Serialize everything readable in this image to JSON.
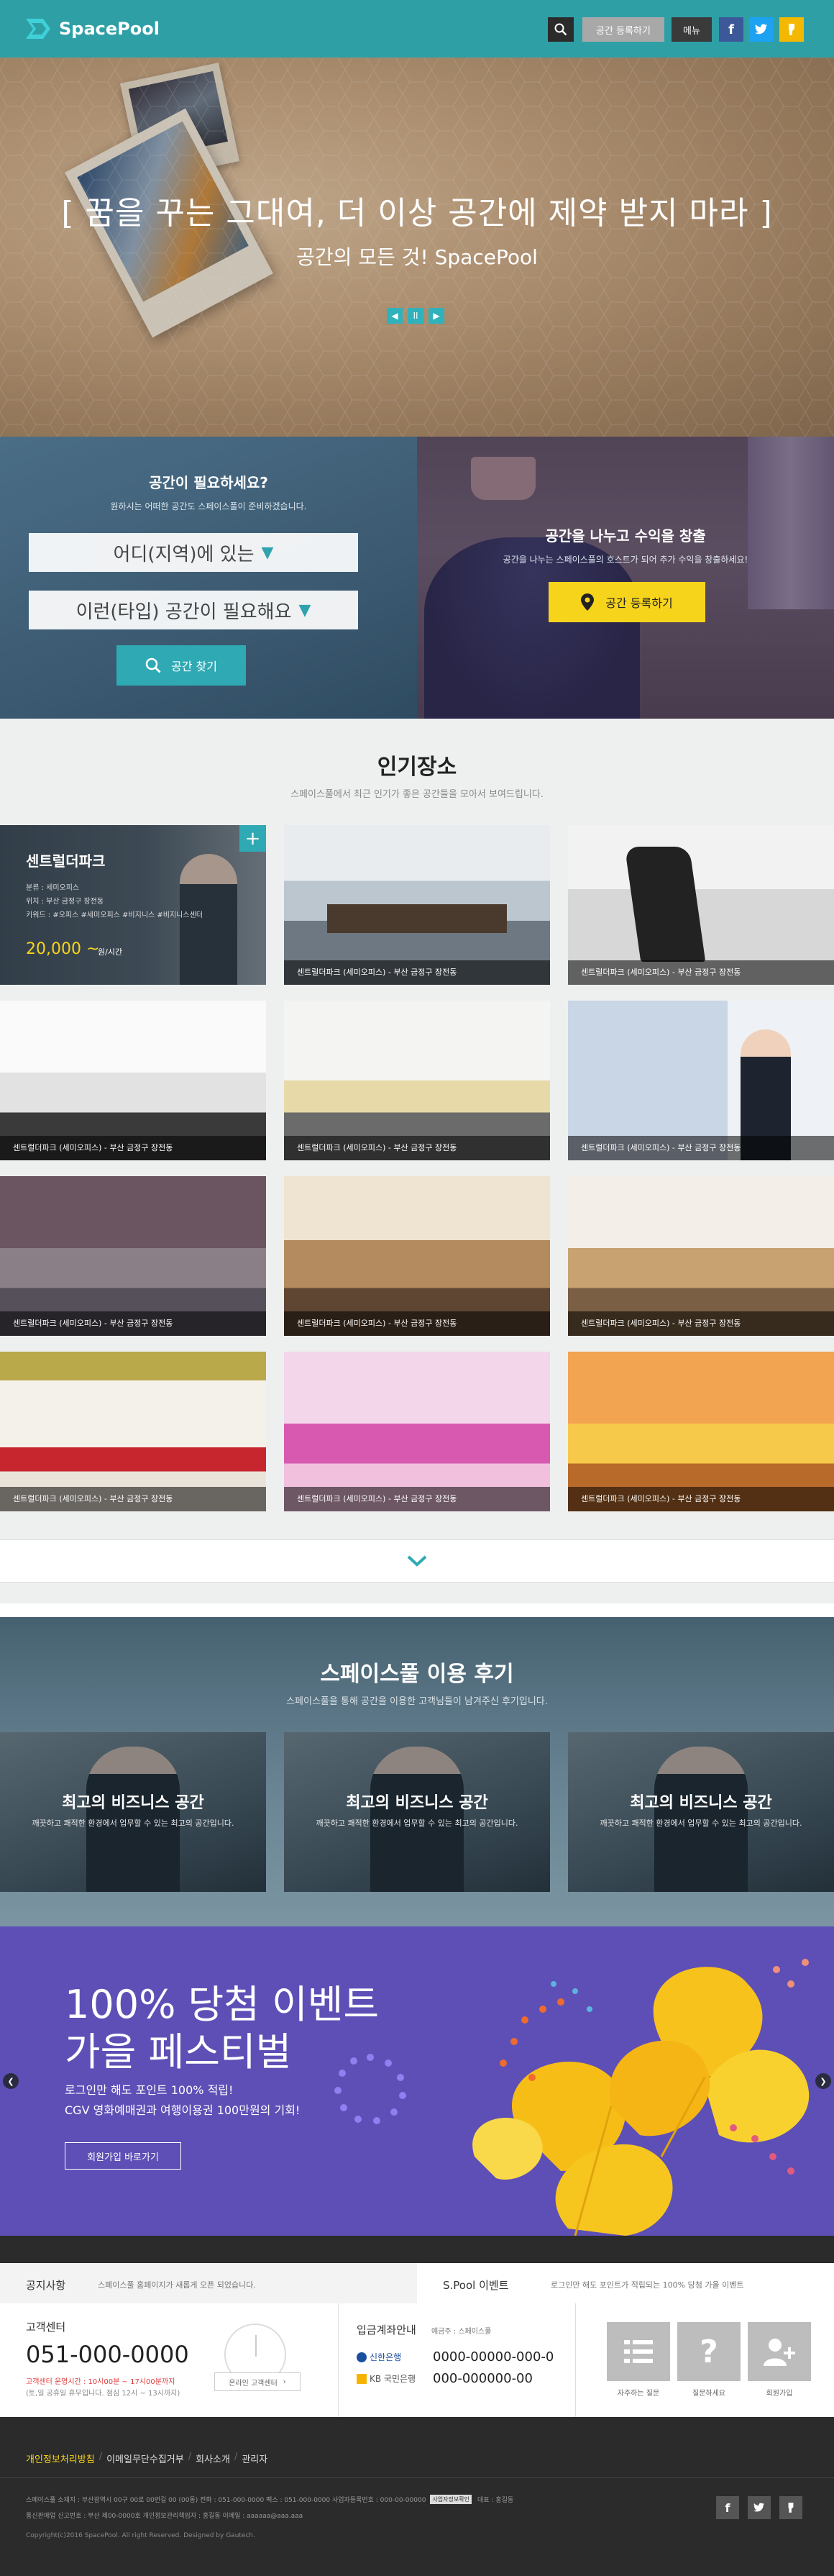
{
  "header": {
    "logo": "SpacePool",
    "register_label": "공간 등록하기",
    "menu_label": "메뉴",
    "colors": {
      "brand": "#2f9fa6",
      "accent": "#f7d41c"
    }
  },
  "hero": {
    "title": "[ 꿈을 꾸는 그대여, 더 이상 공간에 제약 받지 마라 ]",
    "subtitle": "공간의 모든 것! SpacePool",
    "pause_label": "II"
  },
  "find": {
    "title": "공간이 필요하세요?",
    "desc": "원하시는 어떠한 공간도 스페이스풀이 준비하겠습니다.",
    "select_region": "어디(지역)에 있는",
    "select_type": "이런(타입) 공간이 필요해요",
    "search_label": "공간 찾기"
  },
  "offer": {
    "title": "공간을 나누고 수익을 창출",
    "desc": "공간을 나누는 스페이스풀의 호스트가 되어 추가 수익을 창출하세요!",
    "register_label": "공간 등록하기"
  },
  "popular": {
    "title": "인기장소",
    "subtitle": "스페이스풀에서 최근 인기가 좋은 공간들을 모아서 보여드립니다.",
    "featured": {
      "name": "센트럴더파크",
      "line1": "분류 : 세미오피스",
      "line2": "위치 : 부산 금정구 장전동",
      "line3": "키워드 : #오피스 #세미오피스 #비지니스 #비지니스센터",
      "price": "20,000 ~",
      "unit": "원/시간"
    },
    "captions": [
      "센트럴더파크 (세미오피스) - 부산 금정구 장전동",
      "센트럴더파크 (세미오피스) - 부산 금정구 장전동",
      "센트럴더파크 (세미오피스) - 부산 금정구 장전동",
      "센트럴더파크 (세미오피스) - 부산 금정구 장전동",
      "센트럴더파크 (세미오피스) - 부산 금정구 장전동",
      "센트럴더파크 (세미오피스) - 부산 금정구 장전동",
      "센트럴더파크 (세미오피스) - 부산 금정구 장전동",
      "센트럴더파크 (세미오피스) - 부산 금정구 장전동",
      "센트럴더파크 (세미오피스) - 부산 금정구 장전동",
      "센트럴더파크 (세미오피스) - 부산 금정구 장전동",
      "센트럴더파크 (세미오피스) - 부산 금정구 장전동"
    ]
  },
  "reviews": {
    "title": "스페이스풀 이용 후기",
    "subtitle": "스페이스풀을 통해 공간을 이용한 고객님들이 남겨주신 후기입니다.",
    "items": [
      {
        "title": "최고의 비즈니스 공간",
        "text": "깨끗하고 쾌적한 환경에서 업무할 수 있는 최고의 공간입니다."
      },
      {
        "title": "최고의 비즈니스 공간",
        "text": "깨끗하고 쾌적한 환경에서 업무할 수 있는 최고의 공간입니다."
      },
      {
        "title": "최고의 비즈니스 공간",
        "text": "깨끗하고 쾌적한 환경에서 업무할 수 있는 최고의 공간입니다."
      }
    ]
  },
  "event": {
    "title1": "100% 당첨 이벤트",
    "title2": "가을 페스티벌",
    "line1": "로그인만 해도  포인트 100% 적립!",
    "line2": "CGV 영화예매권과 여행이용권 100만원의 기회!",
    "button": "회원가입 바로가기"
  },
  "notice": {
    "label": "공지사항",
    "text": "스페이스풀 홈페이지가 새롭게 오픈 되었습니다.",
    "event_label": "S.Pool 이벤트",
    "event_text": "로그인만 해도 포인트가 적립되는 100% 당첨 가을 이벤트"
  },
  "customer": {
    "label": "고객센터",
    "phone": "051-000-0000",
    "hours": "고객센터 운영시간 : 10시00분 ~ 17시00분까지",
    "note": "(토,일 공휴일 휴무입니다. 점심 12시 ~ 13시까지)",
    "chat": "온라인 고객센터"
  },
  "bank": {
    "label": "입금계좌안내",
    "holder": "예금주 : 스페이스풀",
    "bank1": "신한은행",
    "acc1": "0000-00000-000-0",
    "bank2": "KB 국민은행",
    "acc2": "000-000000-00"
  },
  "quick": [
    {
      "icon": "list-icon",
      "label": "자주하는 질문"
    },
    {
      "icon": "question-icon",
      "label": "질문하세요"
    },
    {
      "icon": "add-user-icon",
      "label": "회원가입"
    }
  ],
  "footer": {
    "links": [
      "개인정보처리방침",
      "이메일무단수집거부",
      "회사소개",
      "관리자"
    ],
    "line1": "스페이스풀   소재지 : 부산광역시 00구 00로 00번길 00 (00동)   전화 : 051-000-0000   팩스 : 051-000-0000   사업자등록번호 : 000-00-00000",
    "badge": "사업자정보확인",
    "ceo": "대표 : 홍길동",
    "line2": "통신판매업 신고번호 : 부산 제00-0000호   개인정보관리책임자 : 홍길동   이메일 : aaaaaa@aaa.aaa",
    "copyright": "Copyright(c)2016 SpacePool. All right Reserved. Designed by Gautech."
  }
}
